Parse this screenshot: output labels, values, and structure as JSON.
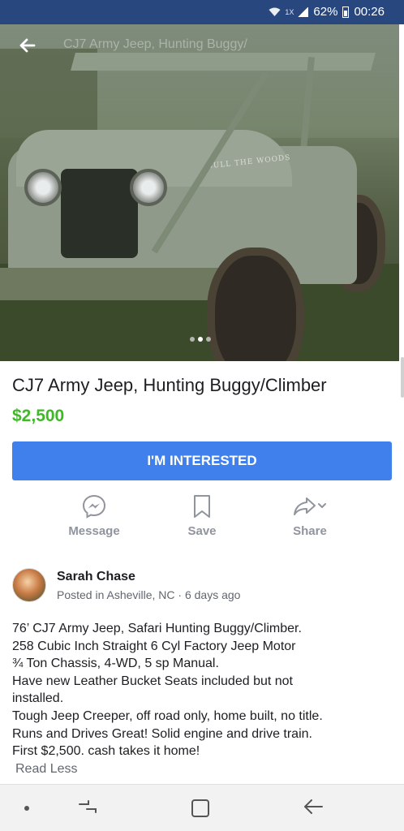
{
  "status_bar": {
    "network_badge": "1X",
    "battery": "62%",
    "time": "00:26"
  },
  "hero": {
    "ghost_title": "CJ7 Army Jeep, Hunting Buggy/",
    "hood_text": "BULL  THE WOODS",
    "image_count": 3,
    "active_index": 1
  },
  "listing": {
    "title": "CJ7 Army Jeep, Hunting Buggy/Climber",
    "price": "$2,500",
    "interested_label": "I'M INTERESTED"
  },
  "actions": {
    "message_label": "Message",
    "save_label": "Save",
    "share_label": "Share"
  },
  "seller": {
    "name": "Sarah Chase",
    "meta": "Posted in Asheville, NC · 6 days ago"
  },
  "description": {
    "lines": [
      "76’ CJ7 Army Jeep, Safari Hunting Buggy/Climber.",
      "258 Cubic Inch Straight 6 Cyl Factory Jeep Motor",
      "¾ Ton Chassis, 4-WD, 5 sp Manual.",
      "Have new Leather Bucket Seats included but not",
      "installed.",
      "Tough Jeep Creeper, off road only, home built, no title.",
      "Runs and Drives Great! Solid engine and drive train.",
      "First $2,500. cash takes it home!"
    ],
    "read_less": "Read Less"
  },
  "colors": {
    "status_bar": "#29477f",
    "accent_button": "#4080ec",
    "price_green": "#42b72a",
    "muted_text": "#90949c"
  }
}
